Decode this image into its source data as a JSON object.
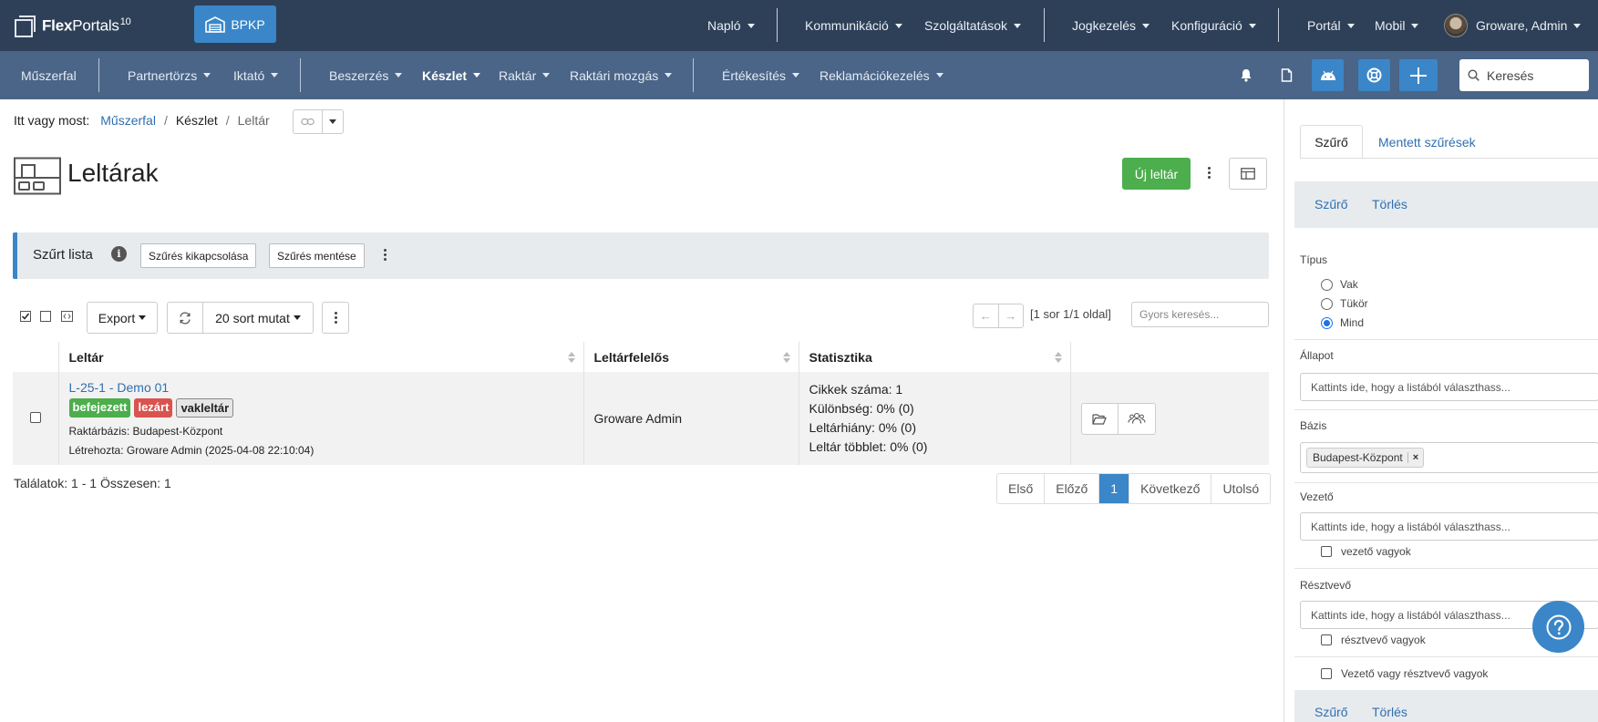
{
  "app": {
    "brand_prefix": "Flex",
    "brand_suffix": "Portals",
    "brand_version": "10",
    "company_button": "BPKP"
  },
  "topnav": {
    "naplo": "Napló",
    "kommunikacio": "Kommunikáció",
    "szolgaltatasok": "Szolgáltatások",
    "jogkezeles": "Jogkezelés",
    "konfiguracio": "Konfiguráció",
    "portal": "Portál",
    "mobil": "Mobil",
    "user": "Groware, Admin"
  },
  "subnav": {
    "muszerfal": "Műszerfal",
    "partnertorzs": "Partnertörzs",
    "iktato": "Iktató",
    "beszerzes": "Beszerzés",
    "keszlet": "Készlet",
    "raktar": "Raktár",
    "raktari_mozgas": "Raktári mozgás",
    "ertekesites": "Értékesítés",
    "reklamacio": "Reklamációkezelés",
    "search_placeholder": "Keresés"
  },
  "breadcrumb": {
    "prefix": "Itt vagy most:",
    "items": [
      "Műszerfal",
      "Készlet",
      "Leltár"
    ]
  },
  "page": {
    "title": "Leltárak",
    "new_button": "Új leltár"
  },
  "filterbar": {
    "title": "Szűrt lista",
    "disable_button": "Szűrés kikapcsolása",
    "save_button": "Szűrés mentése"
  },
  "toolbar": {
    "export": "Export",
    "rows": "20 sort mutat",
    "page_info": "[1 sor 1/1 oldal]",
    "quick_search_placeholder": "Gyors keresés..."
  },
  "table": {
    "columns": [
      "Leltár",
      "Leltárfelelős",
      "Statisztika"
    ],
    "rows": [
      {
        "title": "L-25-1 - Demo 01",
        "badges": [
          "befejezett",
          "lezárt",
          "vakleltár"
        ],
        "base": "Raktárbázis: Budapest-Központ",
        "created": "Létrehozta: Groware Admin (2025-04-08 22:10:04)",
        "responsible": "Groware Admin",
        "stats": [
          "Cikkek száma: 1",
          "Különbség: 0% (0)",
          "Leltárhiány: 0% (0)",
          "Leltár többlet: 0% (0)"
        ]
      }
    ]
  },
  "footer": {
    "results": "Találatok: 1 - 1 Összesen: 1",
    "pages": [
      "Első",
      "Előző",
      "1",
      "Következő",
      "Utolsó"
    ]
  },
  "panel": {
    "tab_filter": "Szűrő",
    "tab_saved": "Mentett szűrések",
    "action_filter": "Szűrő",
    "action_clear": "Törlés",
    "type_label": "Típus",
    "type_options": [
      "Vak",
      "Tükör",
      "Mind"
    ],
    "type_selected": "Mind",
    "status_label": "Állapot",
    "select_placeholder": "Kattints ide, hogy a listából választhass...",
    "base_label": "Bázis",
    "base_chip": "Budapest-Központ",
    "base_chip_remove": "×",
    "leader_label": "Vezető",
    "leader_check": "vezető vagyok",
    "participant_label": "Résztvevő",
    "participant_check": "résztvevő vagyok",
    "either_check": "Vezető vagy résztvevő vagyok"
  },
  "colors": {
    "topbar": "#2e4058",
    "subbar": "#4a6587",
    "accent": "#3a86c8",
    "success": "#4cae4c",
    "danger": "#d9534f"
  }
}
